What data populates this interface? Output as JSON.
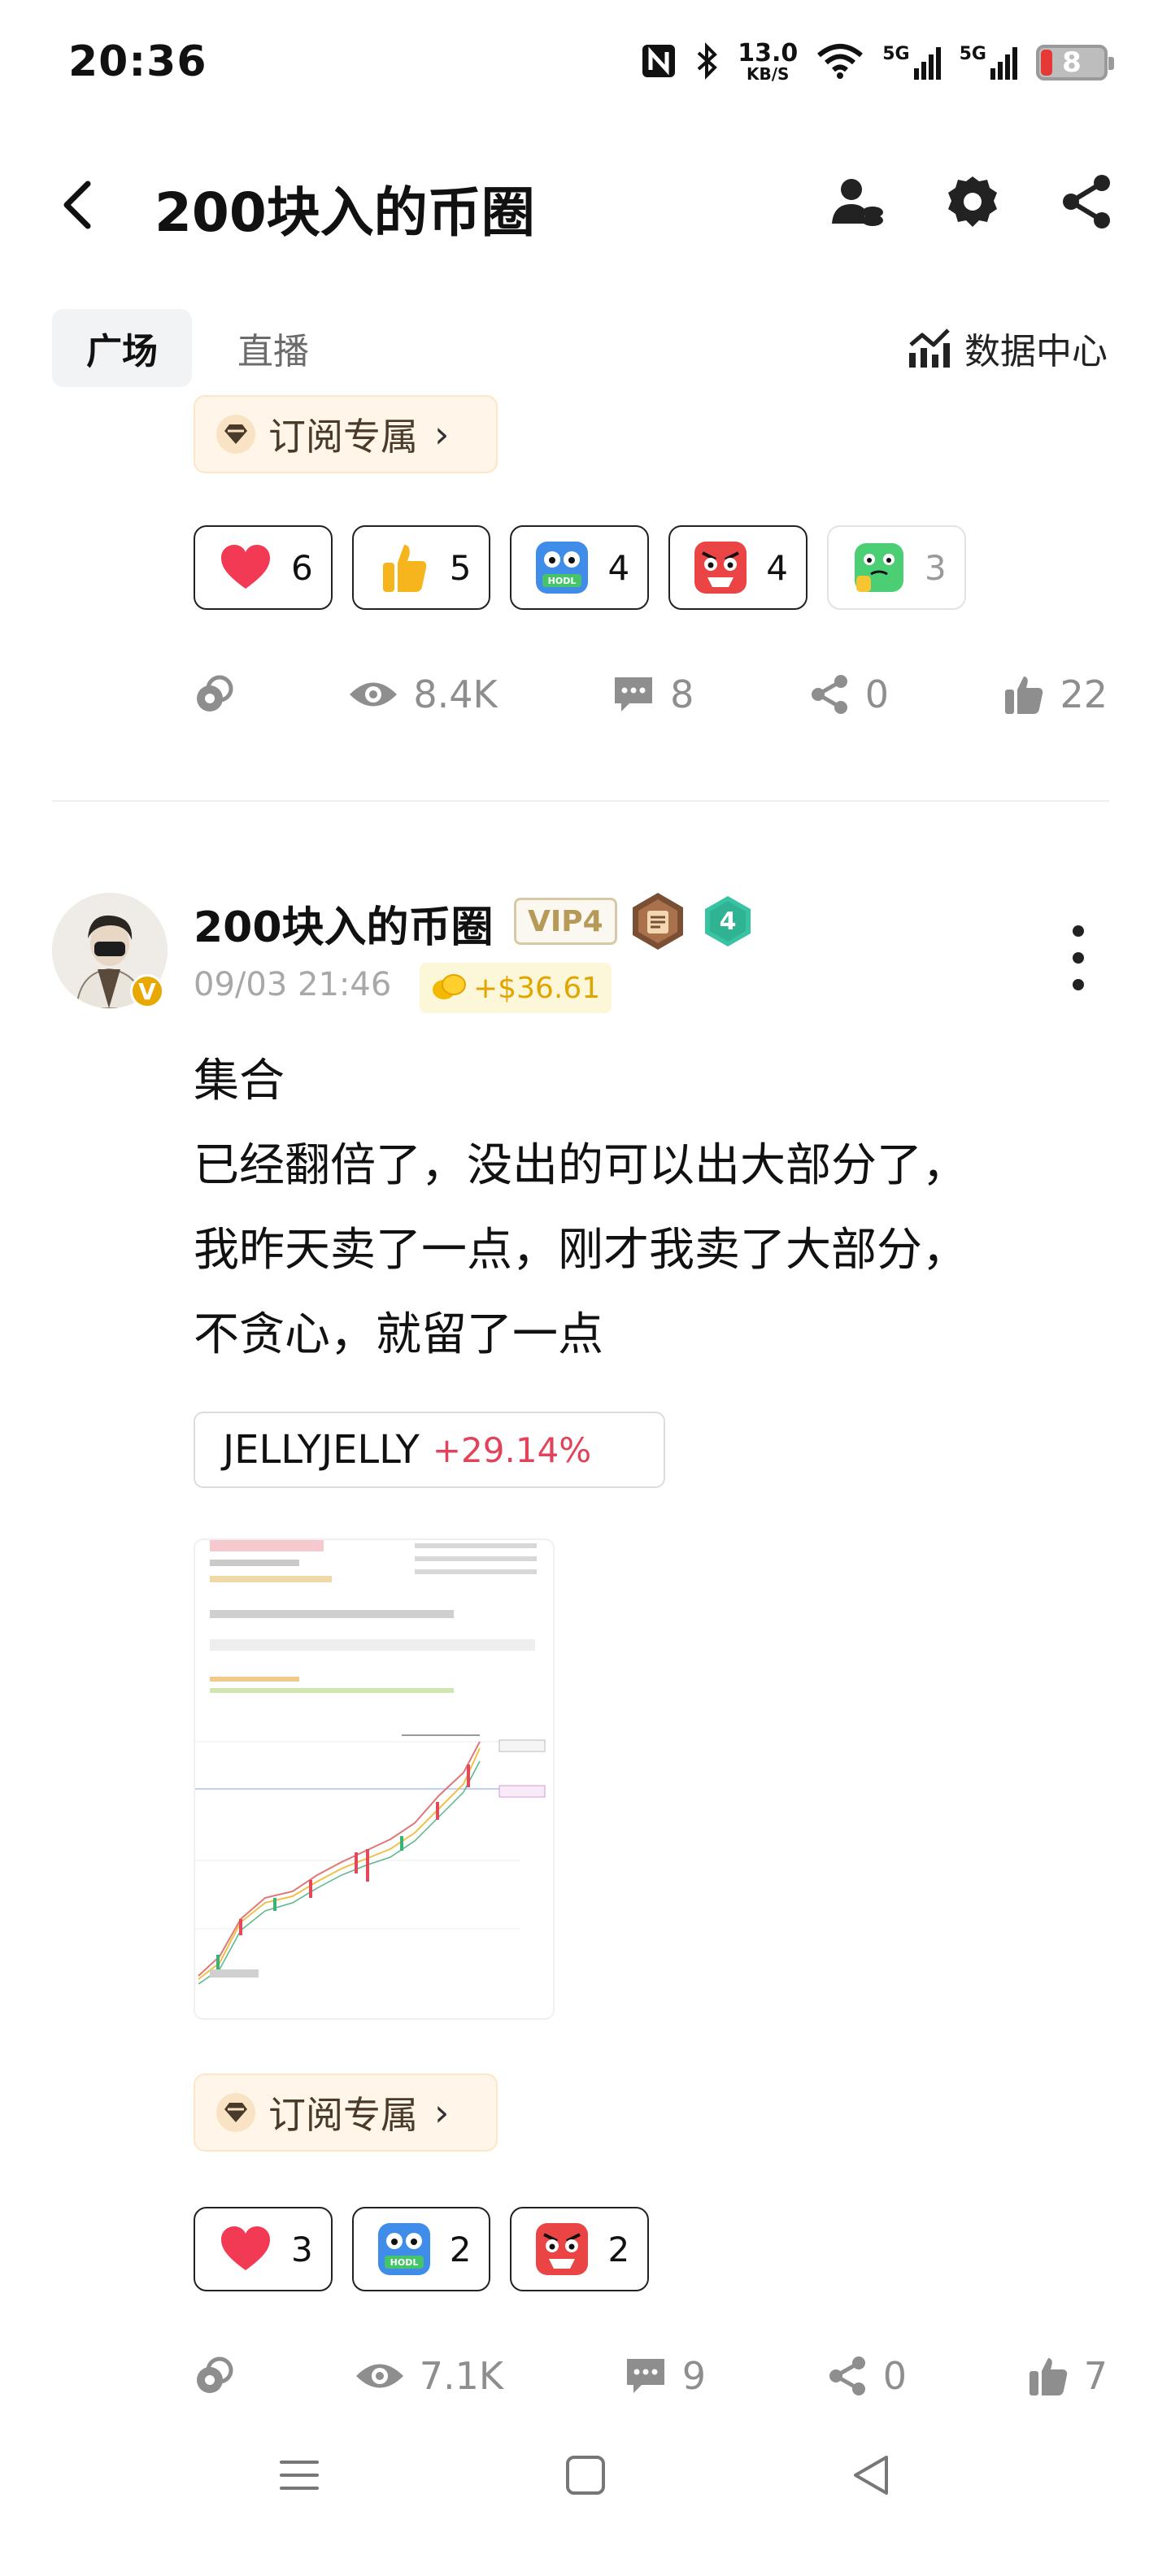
{
  "status_bar": {
    "time": "20:36",
    "net_speed_top": "13.0",
    "net_speed_bottom": "KB/S",
    "signal1": "5G",
    "signal2": "5G",
    "battery": "8"
  },
  "header": {
    "title": "200块入的币圈"
  },
  "tabs": {
    "items": [
      {
        "label": "广场",
        "active": true
      },
      {
        "label": "直播",
        "active": false
      }
    ],
    "data_center_label": "数据中心"
  },
  "post1": {
    "subscribe_label": "订阅专属",
    "reactions": [
      {
        "icon": "heart-emoji",
        "count": "6"
      },
      {
        "icon": "thumbs-up-emoji",
        "count": "5"
      },
      {
        "icon": "hodl-emoji",
        "count": "4"
      },
      {
        "icon": "angry-face-emoji",
        "count": "4"
      },
      {
        "icon": "thinking-frog-emoji",
        "count": "3"
      }
    ],
    "stats": {
      "views": "8.4K",
      "comments": "8",
      "shares": "0",
      "likes": "22"
    }
  },
  "post2": {
    "author": "200块入的币圈",
    "vip_label": "VIP4",
    "level_badge": "4",
    "time": "09/03 21:46",
    "tip_amount": "+$36.61",
    "body_lines": [
      "集合",
      "已经翻倍了，没出的可以出大部分了，",
      "我昨天卖了一点，刚才我卖了大部分，",
      "不贪心，就留了一点"
    ],
    "ticker": {
      "name": "JELLYJELLY",
      "change": "+29.14%"
    },
    "subscribe_label": "订阅专属",
    "reactions": [
      {
        "icon": "heart-emoji",
        "count": "3"
      },
      {
        "icon": "hodl-emoji",
        "count": "2"
      },
      {
        "icon": "angry-face-emoji",
        "count": "2"
      }
    ],
    "stats": {
      "views": "7.1K",
      "comments": "9",
      "shares": "0",
      "likes": "7"
    }
  },
  "colors": {
    "accent_red": "#e2435b",
    "subscribe_bg": "#fff5e9",
    "tip_gold": "#e2a500"
  }
}
